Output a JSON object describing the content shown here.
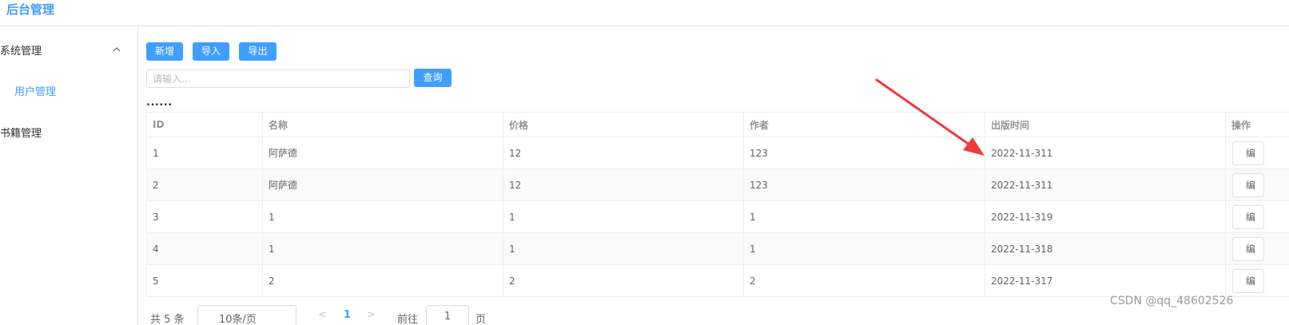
{
  "header": {
    "title": "后台管理"
  },
  "sidebar": {
    "groups": [
      {
        "label": "系统管理",
        "expanded": true,
        "icon": "chevron-up-icon",
        "items": [
          {
            "label": "用户管理",
            "active": true
          }
        ]
      },
      {
        "label": "书籍管理",
        "expanded": false
      }
    ]
  },
  "toolbar": {
    "add_label": "新增",
    "import_label": "导入",
    "export_label": "导出",
    "search_placeholder": "请输入...",
    "query_label": "查询"
  },
  "ellipsis_text": "......",
  "table": {
    "columns": [
      "ID",
      "名称",
      "价格",
      "作者",
      "出版时间",
      "操作"
    ],
    "rows": [
      [
        "1",
        "阿萨德",
        "12",
        "123",
        "2022-11-311"
      ],
      [
        "2",
        "阿萨德",
        "12",
        "123",
        "2022-11-311"
      ],
      [
        "3",
        "1",
        "1",
        "1",
        "2022-11-319"
      ],
      [
        "4",
        "1",
        "1",
        "1",
        "2022-11-318"
      ],
      [
        "5",
        "2",
        "2",
        "2",
        "2022-11-317"
      ]
    ],
    "edit_label": "编"
  },
  "pagination": {
    "total_text": "共 5 条",
    "page_size_text": "10条/页",
    "prev_icon": "<",
    "current_page": "1",
    "next_icon": ">",
    "goto_label": "前往",
    "goto_value": "1",
    "unit_label": "页"
  },
  "annotation": {
    "color": "#f03a3a"
  },
  "watermark": "CSDN @qq_48602526",
  "colors": {
    "primary": "#409eff",
    "border": "#dcdfe6",
    "text": "#606266",
    "header_text": "#909399"
  }
}
